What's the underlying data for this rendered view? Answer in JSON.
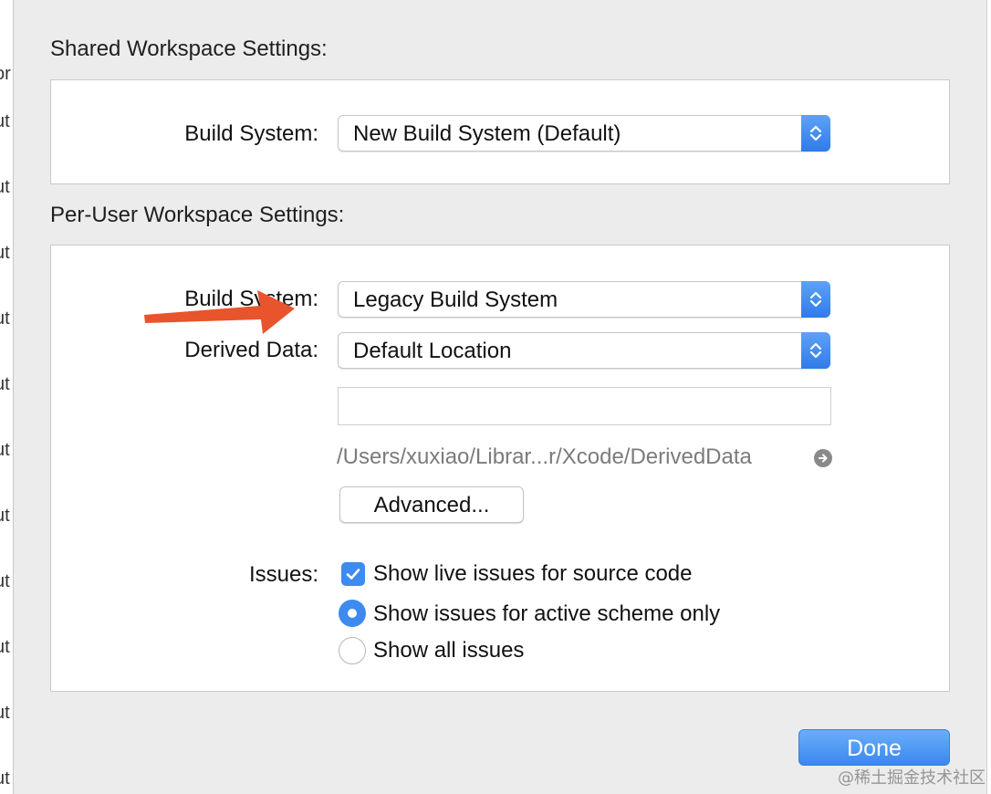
{
  "shared": {
    "title": "Shared Workspace Settings:",
    "build_system_label": "Build System:",
    "build_system_value": "New Build System (Default)"
  },
  "per_user": {
    "title": "Per-User Workspace Settings:",
    "build_system_label": "Build System:",
    "build_system_value": "Legacy Build System",
    "derived_data_label": "Derived Data:",
    "derived_data_value": "Default Location",
    "custom_path_value": "",
    "derived_data_path": "/Users/xuxiao/Librar...r/Xcode/DerivedData",
    "advanced_button": "Advanced...",
    "issues_label": "Issues:",
    "issues_options": {
      "live_issues": "Show live issues for source code",
      "active_scheme": "Show issues for active scheme only",
      "all_issues": "Show all issues"
    }
  },
  "done_button": "Done",
  "background_window": {
    "left_stubs": [
      "or",
      "ut",
      "ut",
      "ut",
      "ut",
      "ut",
      "ut",
      "ut",
      "ut",
      "ut",
      "ut",
      "ut"
    ]
  },
  "watermark": "@稀土掘金技术社区",
  "colors": {
    "accent": "#3d8af0",
    "annotation_arrow": "#e8542b",
    "sheet_background": "#ececec"
  },
  "icons": {
    "stepper": "up-down-chevron-icon",
    "reveal": "arrow-circle-right-icon",
    "checkmark": "checkmark-icon"
  }
}
